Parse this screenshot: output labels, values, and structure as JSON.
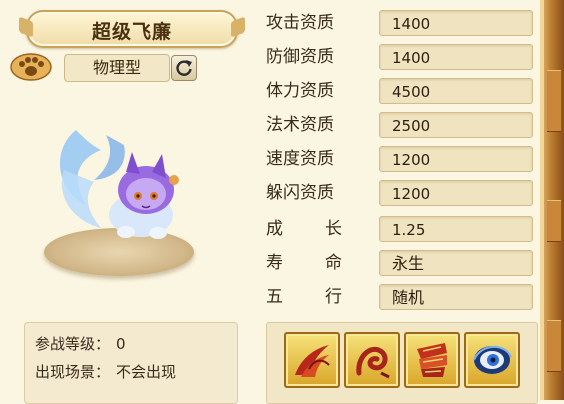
{
  "pet": {
    "name": "超级飞廉",
    "type_label": "物理型"
  },
  "stats": [
    {
      "label": "攻击资质",
      "value": "1400"
    },
    {
      "label": "防御资质",
      "value": "1400"
    },
    {
      "label": "体力资质",
      "value": "4500"
    },
    {
      "label": "法术资质",
      "value": "2500"
    },
    {
      "label": "速度资质",
      "value": "1200"
    },
    {
      "label": "躲闪资质",
      "value": "1200"
    },
    {
      "label_chars": [
        "成",
        "长"
      ],
      "value": "1.25"
    },
    {
      "label_chars": [
        "寿",
        "命"
      ],
      "value": "永生"
    },
    {
      "label_chars": [
        "五",
        "行"
      ],
      "value": "随机"
    }
  ],
  "info": {
    "battle_level_label": "参战等级：",
    "battle_level_value": "0",
    "appear_scene_label": "出现场景：",
    "appear_scene_value": "不会出现"
  },
  "skills": [
    {
      "icon": "wind-slash-icon"
    },
    {
      "icon": "whirl-claw-icon"
    },
    {
      "icon": "scroll-blade-icon"
    },
    {
      "icon": "eye-vortex-icon"
    }
  ],
  "colors": {
    "background": "#fbf6e2",
    "value_box": "#f0e4c0",
    "skill_gold": "#d9a52a",
    "skill_red": "#b8261c",
    "pet_purple": "#8a5ad6",
    "pet_blue": "#7fb6f0"
  }
}
